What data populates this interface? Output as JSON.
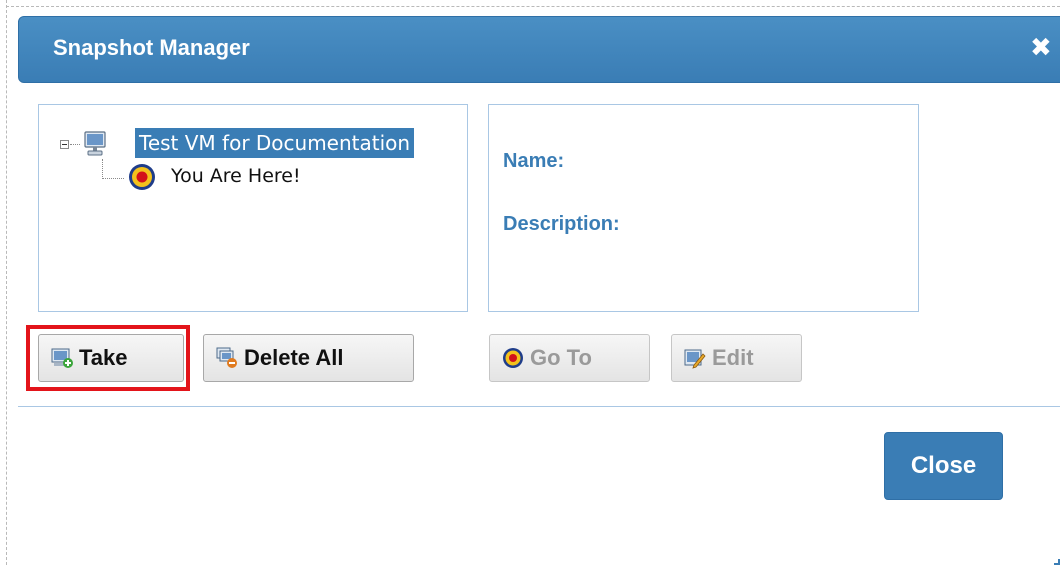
{
  "dialog": {
    "title": "Snapshot Manager",
    "close_icon": "close-icon"
  },
  "tree": {
    "root": {
      "label": "Test VM for Documentation",
      "icon": "computer-icon",
      "expanded": true,
      "selected": true
    },
    "children": [
      {
        "label": "You Are Here!",
        "icon": "target-icon"
      }
    ]
  },
  "details": {
    "name_label": "Name:",
    "description_label": "Description:"
  },
  "toolbar": {
    "take_label": "Take",
    "delete_all_label": "Delete All",
    "goto_label": "Go To",
    "edit_label": "Edit"
  },
  "footer": {
    "close_label": "Close"
  },
  "colors": {
    "accent": "#3a7db5",
    "highlight": "#e3141a",
    "panel_border": "#a9c7e4"
  }
}
